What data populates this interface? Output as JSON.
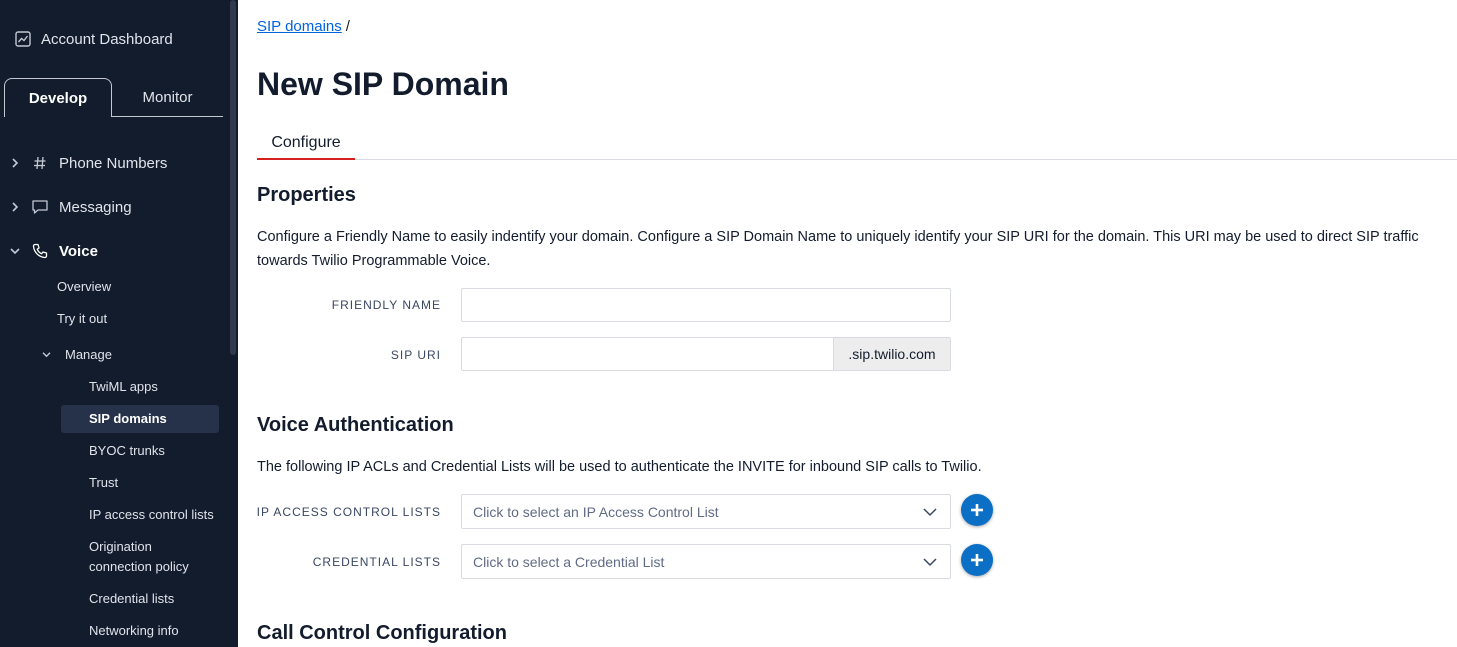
{
  "sidebar": {
    "account_dashboard": "Account Dashboard",
    "tabs": {
      "develop": "Develop",
      "monitor": "Monitor"
    },
    "phone_numbers": "Phone Numbers",
    "messaging": "Messaging",
    "voice": "Voice",
    "voice_items": {
      "overview": "Overview",
      "try_it_out": "Try it out",
      "manage": "Manage"
    },
    "manage_items": [
      "TwiML apps",
      "SIP domains",
      "BYOC trunks",
      "Trust",
      "IP access control lists",
      "Origination connection policy",
      "Credential lists",
      "Networking info"
    ]
  },
  "main": {
    "breadcrumb": {
      "link": "SIP domains",
      "separator": "/"
    },
    "title": "New SIP Domain",
    "tab_configure": "Configure",
    "properties": {
      "title": "Properties",
      "description": "Configure a Friendly Name to easily indentify your domain. Configure a SIP Domain Name to uniquely identify your SIP URI for the domain. This URI may be used to direct SIP traffic towards Twilio Programmable Voice.",
      "friendly_name_label": "FRIENDLY NAME",
      "friendly_name_value": "",
      "sip_uri_label": "SIP URI",
      "sip_uri_value": "",
      "sip_uri_suffix": ".sip.twilio.com"
    },
    "voice_auth": {
      "title": "Voice Authentication",
      "description": "The following IP ACLs and Credential Lists will be used to authenticate the INVITE for inbound SIP calls to Twilio.",
      "ip_acl_label": "IP ACCESS CONTROL LISTS",
      "ip_acl_placeholder": "Click to select an IP Access Control List",
      "cred_label": "CREDENTIAL LISTS",
      "cred_placeholder": "Click to select a Credential List"
    },
    "call_control": {
      "title": "Call Control Configuration"
    }
  },
  "colors": {
    "sidebar_bg": "#121c2d",
    "link": "#0263e0",
    "tab_accent": "#d61f1f",
    "add_button": "#0b6fc5"
  }
}
